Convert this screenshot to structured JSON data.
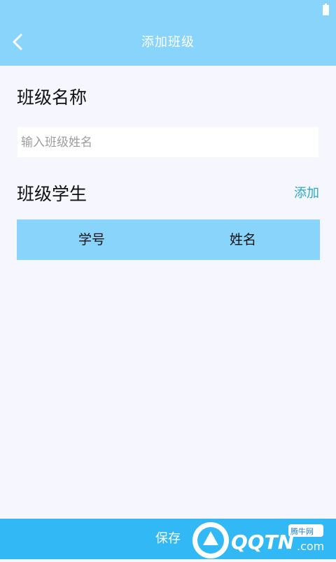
{
  "header": {
    "title": "添加班级"
  },
  "form": {
    "name_label": "班级名称",
    "name_placeholder": "输入班级姓名",
    "name_value": ""
  },
  "students": {
    "section_title": "班级学生",
    "add_label": "添加",
    "columns": [
      "学号",
      "姓名"
    ]
  },
  "footer": {
    "save_label": "保存"
  },
  "watermark": {
    "text": "QQTN",
    "suffix": ".com",
    "badge": "腾牛网"
  },
  "colors": {
    "header_bg": "#89d4fb",
    "footer_bg": "#32b9f5",
    "accent_link": "#2aa8c8",
    "page_bg": "#f6f6fe"
  },
  "icons": {
    "back": "chevron-left-icon",
    "battery": "battery-icon"
  }
}
